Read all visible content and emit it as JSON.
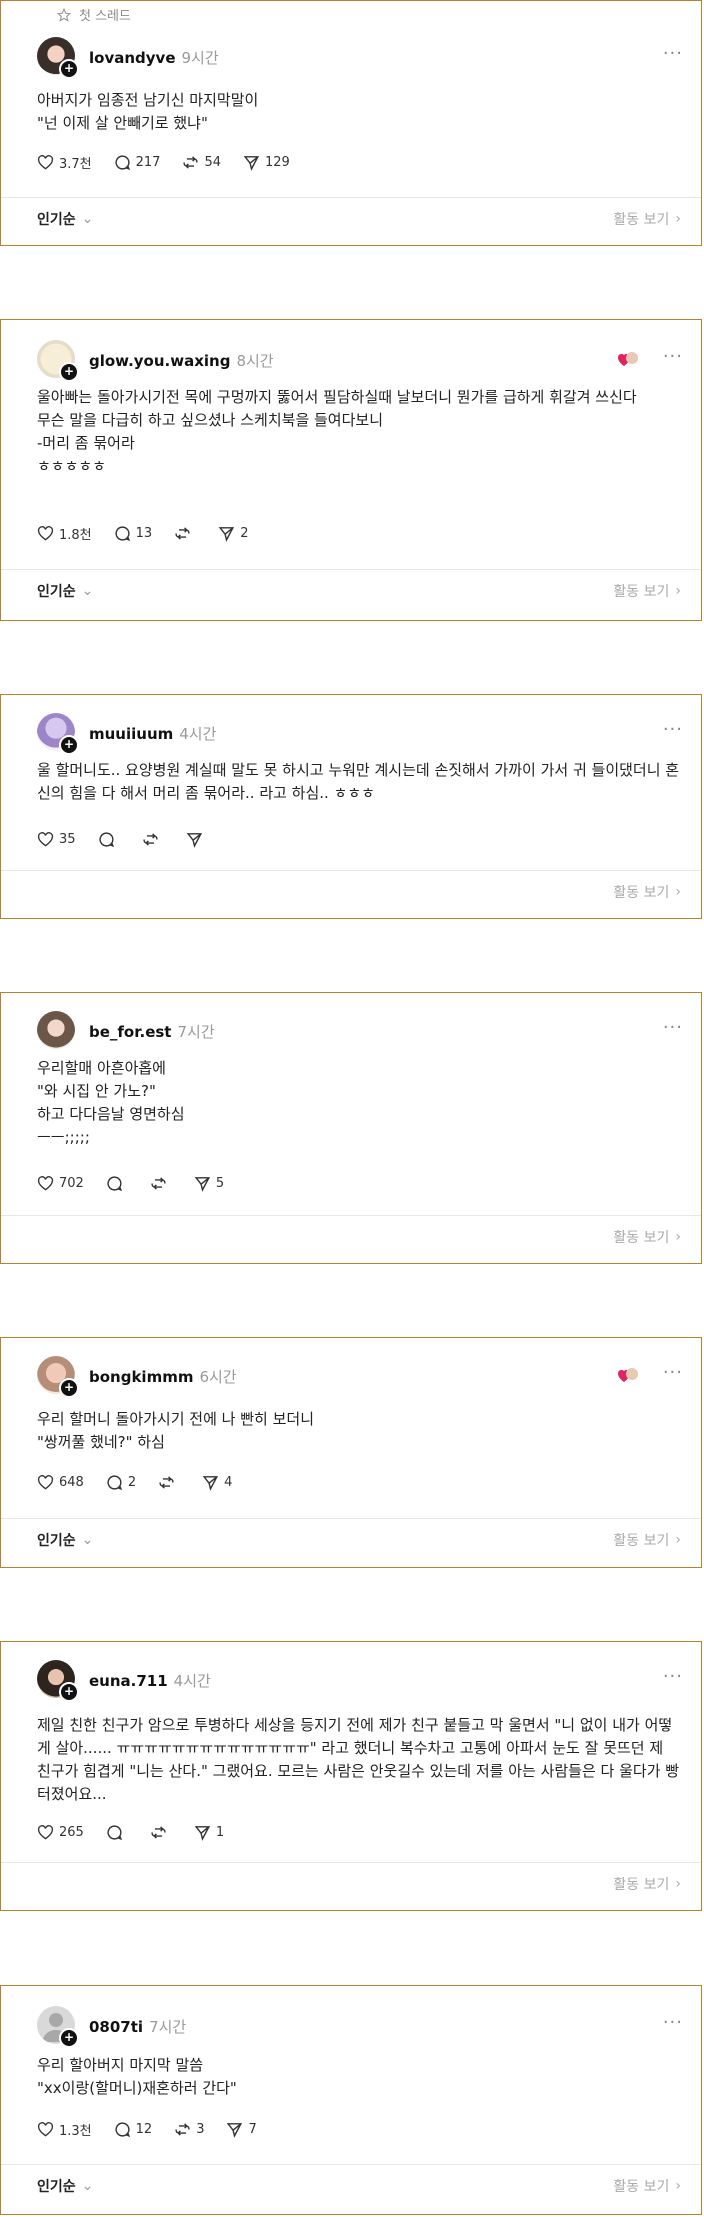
{
  "header": {
    "first_thread_label": "첫 스레드"
  },
  "common": {
    "popular_label": "인기순",
    "see_activity_label": "활동 보기"
  },
  "posts": [
    {
      "username": "lovandyve",
      "time": "9시간",
      "body": "아버지가 임종전 남기신 마지막말이\n\"넌 이제 살 안빼기로 했냐\"",
      "likes": "3.7천",
      "comments": "217",
      "reposts": "54",
      "shares": "129"
    },
    {
      "username": "glow.you.waxing",
      "time": "8시간",
      "body": "울아빠는 돌아가시기전 목에 구멍까지 뚫어서 필담하실때 날보더니 뭔가를 급하게 휘갈겨 쓰신다\n무슨 말을 다급히 하고 싶으셨나 스케치북을 들여다보니\n-머리 좀 묶어라\nㅎㅎㅎㅎㅎ",
      "likes": "1.8천",
      "comments": "13",
      "reposts": "",
      "shares": "2"
    },
    {
      "username": "muuiiuum",
      "time": "4시간",
      "body": "울 할머니도.. 요양병원 계실때 말도 못 하시고 누워만 계시는데 손짓해서 가까이 가서 귀 들이댔더니 혼신의 힘을 다 해서 머리 좀 묶어라.. 라고 하심.. ㅎㅎㅎ",
      "likes": "35",
      "comments": "",
      "reposts": "",
      "shares": ""
    },
    {
      "username": "be_for.est",
      "time": "7시간",
      "body": "우리할매 아흔아홉에\n\"와 시집 안 가노?\"\n하고 다다음날 영면하심\nㅡㅡ;;;;;",
      "likes": "702",
      "comments": "",
      "reposts": "",
      "shares": "5"
    },
    {
      "username": "bongkimmm",
      "time": "6시간",
      "body": "우리 할머니 돌아가시기 전에 나 빤히 보더니\n\"쌍꺼풀 했네?\" 하심",
      "likes": "648",
      "comments": "2",
      "reposts": "",
      "shares": "4"
    },
    {
      "username": "euna.711",
      "time": "4시간",
      "body": "제일 친한 친구가 암으로 투병하다 세상을 등지기 전에 제가 친구 붙들고 막 울면서 \"니 없이 내가 어떻게 살아...... ㅠㅠㅠㅠㅠㅠㅠㅠㅠㅠㅠㅠㅠㅠ\" 라고 했더니 복수차고 고통에 아파서 눈도 잘 못뜨던 제 친구가 힘겹게 \"니는 산다.\" 그랬어요. 모르는 사람은 안웃길수 있는데 저를 아는 사람들은 다 울다가 빵터졌어요...",
      "likes": "265",
      "comments": "",
      "reposts": "",
      "shares": "1"
    },
    {
      "username": "0807ti",
      "time": "7시간",
      "body": "우리 할아버지 마지막 말씀\n\"xx이랑(할머니)재혼하러 간다\"",
      "likes": "1.3천",
      "comments": "12",
      "reposts": "3",
      "shares": "7"
    }
  ]
}
